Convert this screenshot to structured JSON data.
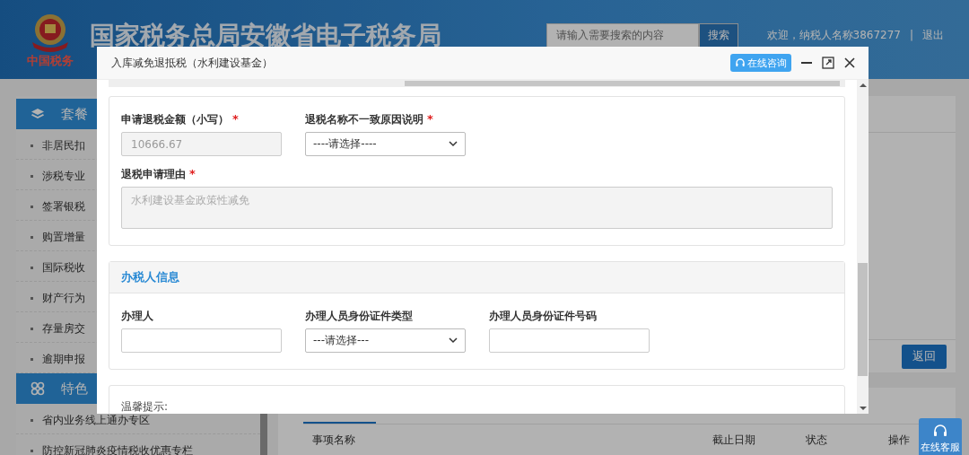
{
  "header": {
    "logo_text": "中国税务",
    "title": "国家税务总局安徽省电子税务局",
    "search": {
      "placeholder": "请输入需要搜索的内容"
    },
    "search_button": "搜索",
    "welcome": "欢迎，纳税人名称3867277",
    "separator": "|",
    "logout": "退出"
  },
  "sidebar": {
    "sections": [
      {
        "title": "套餐",
        "items": [
          "非居民扣",
          "涉税专业",
          "签署银税",
          "购置增量",
          "国际税收",
          "财产行为",
          "存量房交",
          "逾期申报"
        ]
      },
      {
        "title": "特色",
        "items": [
          "省内业务线上通办专区",
          "防控新冠肺炎疫情税收优惠专栏"
        ]
      }
    ]
  },
  "content": {
    "return_button": "返回",
    "table": {
      "columns": [
        "事项名称",
        "截止日期",
        "状态",
        "操作"
      ]
    }
  },
  "float_button": "在线客服",
  "dialog": {
    "title": "入库减免退抵税（水利建设基金）",
    "consult_button": "在线咨询",
    "cards": [
      {
        "rows": [
          [
            {
              "kind": "input",
              "label": "申请退税金额（小写）",
              "required_mark": "*",
              "value": "10666.67",
              "disabled": true
            },
            {
              "kind": "select",
              "label": "退税名称不一致原因说明",
              "required_mark": "*",
              "value": "----请选择----",
              "disabled": false
            }
          ],
          [
            {
              "kind": "textarea",
              "label": "退税申请理由",
              "required_mark": "*",
              "value": "水利建设基金政策性减免",
              "disabled": true
            }
          ]
        ]
      },
      {
        "heading": "办税人信息",
        "rows": [
          [
            {
              "kind": "input",
              "label": "办理人",
              "disabled": false
            },
            {
              "kind": "select",
              "label": "办理人员身份证件类型",
              "value": "---请选择---",
              "disabled": false
            },
            {
              "kind": "input",
              "label": "办理人员身份证件号码",
              "disabled": false
            }
          ]
        ]
      },
      {
        "note": "温馨提示:"
      }
    ]
  }
}
